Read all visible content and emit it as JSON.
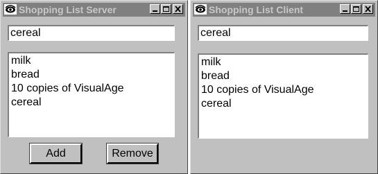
{
  "server": {
    "title": "Shopping List Server",
    "input_value": "cereal",
    "items": [
      "milk",
      "bread",
      "10 copies of VisualAge",
      "cereal"
    ],
    "add_label": "Add",
    "remove_label": "Remove"
  },
  "client": {
    "title": "Shopping List Client",
    "input_value": "cereal",
    "items": [
      "milk",
      "bread",
      "10 copies of VisualAge",
      "cereal"
    ]
  },
  "window_controls": {
    "minimize": "minimize-icon",
    "maximize": "maximize-icon",
    "close": "close-icon"
  },
  "colors": {
    "window_face": "#c0c0c0",
    "inactive_titlebar": "#808080",
    "inactive_title_text": "#c8c8c8",
    "field_background": "#ffffff"
  }
}
